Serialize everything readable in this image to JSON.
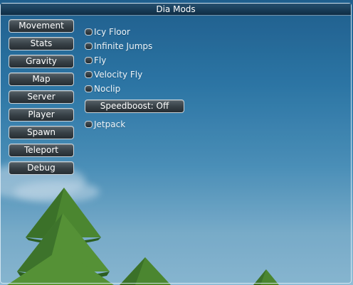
{
  "window": {
    "title": "Dia Mods"
  },
  "tabs": [
    {
      "label": "Movement"
    },
    {
      "label": "Stats"
    },
    {
      "label": "Gravity"
    },
    {
      "label": "Map"
    },
    {
      "label": "Server"
    },
    {
      "label": "Player"
    },
    {
      "label": "Spawn"
    },
    {
      "label": "Teleport"
    },
    {
      "label": "Debug"
    }
  ],
  "movement": {
    "toggles": [
      {
        "label": "Icy Floor",
        "checked": false
      },
      {
        "label": "Infinite Jumps",
        "checked": false
      },
      {
        "label": "Fly",
        "checked": false
      },
      {
        "label": "Velocity Fly",
        "checked": false
      },
      {
        "label": "Noclip",
        "checked": false
      }
    ],
    "speedboost_label": "Speedboost: Off",
    "jetpack": {
      "label": "Jetpack",
      "checked": false
    }
  },
  "colors": {
    "sky_top": "#1f5f8e",
    "sky_bottom": "#8fbdd6",
    "tree_light": "#4f8a2a",
    "tree_dark": "#2d5f1a",
    "titlebar": "#0e2c44"
  }
}
